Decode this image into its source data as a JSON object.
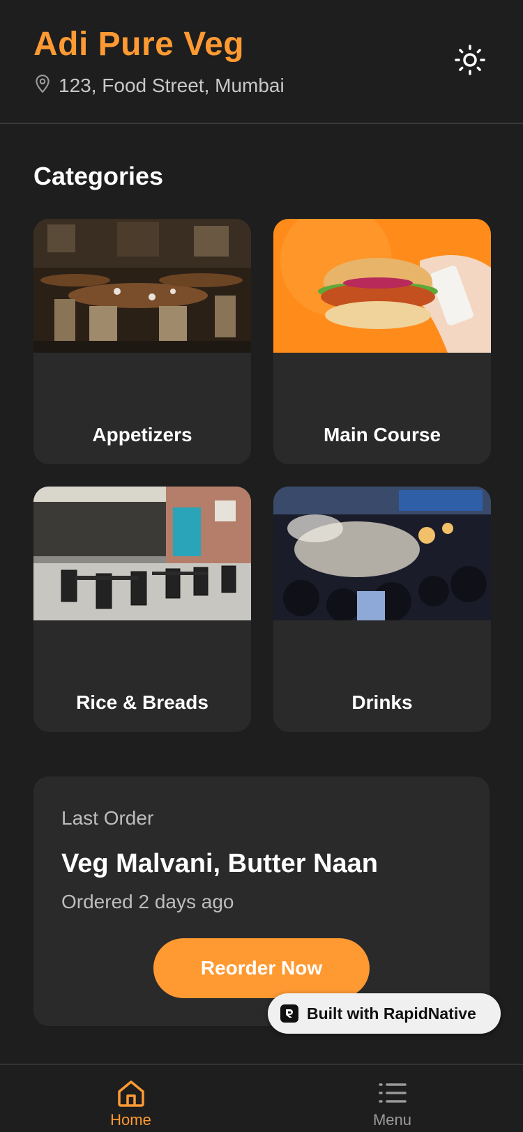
{
  "header": {
    "title": "Adi Pure Veg",
    "address": "123, Food Street, Mumbai",
    "theme_toggle_icon": "sun-icon",
    "location_icon": "map-pin-icon"
  },
  "categories": {
    "title": "Categories",
    "items": [
      {
        "label": "Appetizers",
        "image": "restaurant-interior-photo"
      },
      {
        "label": "Main Course",
        "image": "burger-in-hand-photo"
      },
      {
        "label": "Rice & Breads",
        "image": "outdoor-cafe-seating-photo"
      },
      {
        "label": "Drinks",
        "image": "night-street-food-market-photo"
      }
    ]
  },
  "last_order": {
    "kicker": "Last Order",
    "items": "Veg Malvani, Butter Naan",
    "time": "Ordered 2 days ago",
    "button_label": "Reorder Now"
  },
  "badge": {
    "label": "Built with RapidNative"
  },
  "bottom_nav": {
    "items": [
      {
        "label": "Home",
        "icon": "home-icon",
        "active": true
      },
      {
        "label": "Menu",
        "icon": "list-icon",
        "active": false
      }
    ]
  },
  "colors": {
    "accent": "#ff9a33",
    "background": "#1e1e1e",
    "card": "#2a2a2a",
    "muted_text": "#bdbdbd"
  }
}
